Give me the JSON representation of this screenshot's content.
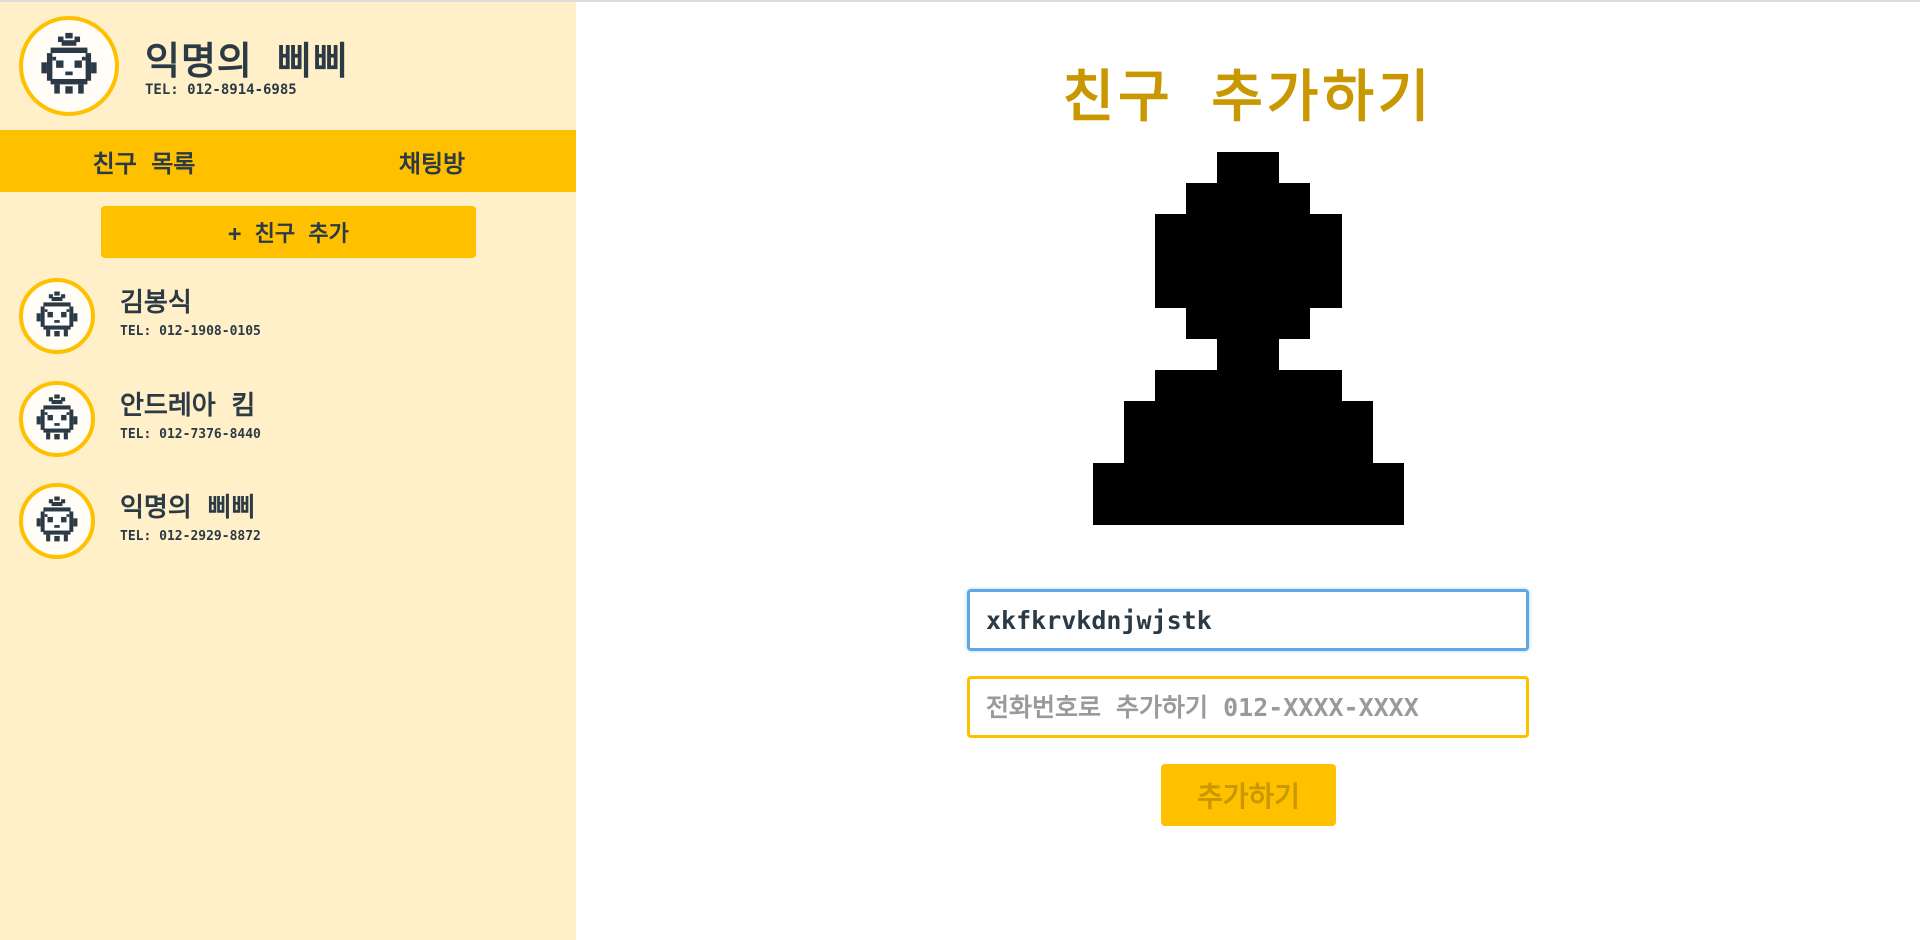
{
  "colors": {
    "accent": "#ffc000",
    "sidebar_bg": "#fff0c9",
    "title": "#c99700",
    "text": "#2b3a45",
    "focus_border": "#5ea8e8"
  },
  "profile": {
    "avatar_icon": "robot-mascot-icon",
    "name": "익명의 삐삐",
    "tel": "TEL: 012-8914-6985"
  },
  "tabs": [
    {
      "label": "친구 목록"
    },
    {
      "label": "채팅방"
    }
  ],
  "add_friend_button": "+ 친구 추가",
  "friends": [
    {
      "name": "김봉식",
      "tel": "TEL: 012-1908-0105"
    },
    {
      "name": "안드레아 킴",
      "tel": "TEL: 012-7376-8440"
    },
    {
      "name": "익명의 삐삐",
      "tel": "TEL: 012-2929-8872"
    }
  ],
  "main": {
    "title": "친구 추가하기",
    "silhouette_icon": "person-silhouette-icon",
    "id_input_value": "xkfkrvkdnjwjstk",
    "phone_input_placeholder": "전화번호로 추가하기 012-XXXX-XXXX",
    "submit_label": "추가하기"
  }
}
